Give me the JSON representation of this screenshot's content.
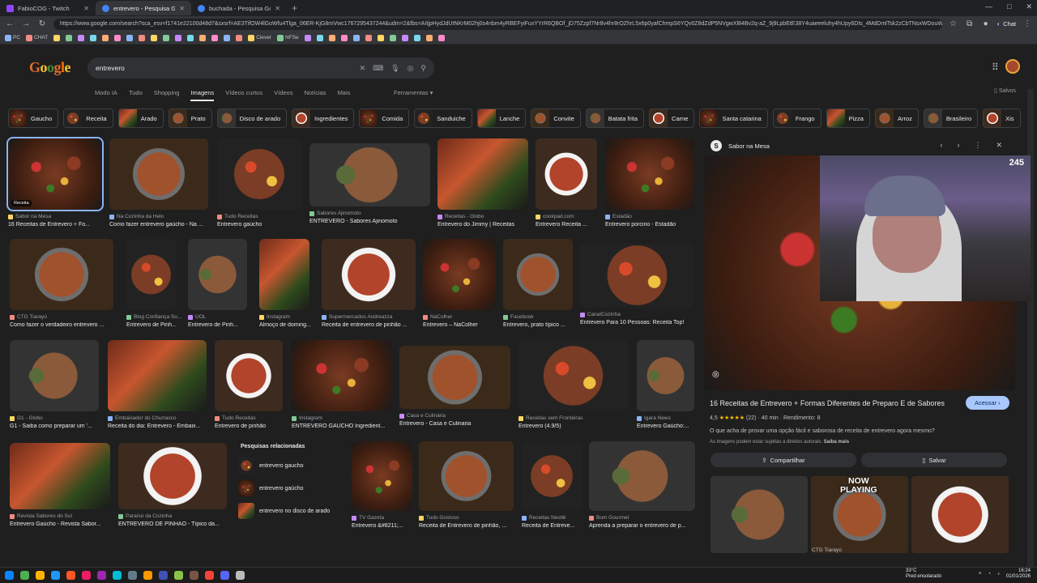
{
  "tabs": [
    {
      "title": "FabioCOG - Twitch",
      "color": "#9146ff"
    },
    {
      "title": "entrevero - Pesquisa Google",
      "color": "#4285f4"
    },
    {
      "title": "buchada - Pesquisa Google",
      "color": "#4285f4"
    }
  ],
  "window_controls": [
    "—",
    "□",
    "✕"
  ],
  "url": "https://www.google.com/search?sca_esv=f1741e22100d48d7&sxsrf=AE3TifOW4lGoWfu4Tlga_06ER-KjG8rnVwc1767295437244&udm=2&fbs=AIIjpHydJdUtNKrM02hj0s4nbm4yRBEFyiFuxYYrR6QBOf_jD75Zzpf7Nr8v4hr8rOZhrL5x6p0yafChmpS6YQv0Z8dZdP5NVgwXl84Bv2q-aZ_9j9LpbEtE38Y4uaeeeluhy4hUpy6DIs_4MdDmlTsk2zCbTNsxWDouWM20Y1P...",
  "chat_label": "Chat",
  "bookmarks": [
    "PC",
    "CHAT",
    "",
    "",
    "",
    "",
    "",
    "",
    "",
    "",
    "",
    "",
    "",
    "",
    "",
    "",
    "",
    "",
    "Clever",
    "NFSe",
    "",
    "",
    "",
    "",
    "",
    "",
    "",
    "",
    "",
    "",
    "",
    ""
  ],
  "search": {
    "query": "entrevero",
    "logo": "Google"
  },
  "search_tabs": [
    "Modo IA",
    "Tudo",
    "Shopping",
    "Imagens",
    "Vídeos curtos",
    "Vídeos",
    "Notícias",
    "Mais"
  ],
  "tools_label": "Ferramentas",
  "saved_label": "Salvos",
  "chips": [
    "Gaucho",
    "Receita",
    "Arado",
    "Prato",
    "Disco de arado",
    "Ingredientes",
    "Comida",
    "Sanduiche",
    "Lanche",
    "Convite",
    "Batata frita",
    "Carne",
    "Santa catarina",
    "Frango",
    "Pizza",
    "Arroz",
    "Brasileiro",
    "Xis"
  ],
  "results": [
    {
      "src": "Sabor na Mesa",
      "title": "16 Receitas de Entrevero + Fo...",
      "badge": "Receita"
    },
    {
      "src": "Na Cozinha da Helo",
      "title": "Como fazer entrevero gaúcho - Na ..."
    },
    {
      "src": "Tudo Receitas",
      "title": "Entrevero gaúcho"
    },
    {
      "src": "Sabores Ajinomoto",
      "title": "ENTREVERO - Sabores Ajinomoto"
    },
    {
      "src": "Receitas - Globo",
      "title": "Entrevero do Jimmy | Receitas"
    },
    {
      "src": "cookpad.com",
      "title": "Entrevero Receita ..."
    },
    {
      "src": "Estadão",
      "title": "Entrevero porcino - Estadão"
    },
    {
      "src": "CTG Tiarayú",
      "title": "Como fazer o verdadeiro entrevero ..."
    },
    {
      "src": "Blog Confiança Su...",
      "title": "Entrevero de Pinh..."
    },
    {
      "src": "UOL",
      "title": "Entrevero de Pinh..."
    },
    {
      "src": "Instagram",
      "title": "Almoço de doming..."
    },
    {
      "src": "Supermercados Andreazza",
      "title": "Receita de entrevero de pinhão ..."
    },
    {
      "src": "NaColher",
      "title": "Entrevero – NaColher"
    },
    {
      "src": "Facebook",
      "title": "Entrevero, prato típico ..."
    },
    {
      "src": "CanalCozinha",
      "title": "Entrevero Para 10 Pessoas: Receita Top!"
    },
    {
      "src": "G1 - Globo",
      "title": "G1 - Saiba como preparar um '..."
    },
    {
      "src": "Embaixador do Churrasco",
      "title": "Receita do dia: Entrevero - Embaix..."
    },
    {
      "src": "Tudo Receitas",
      "title": "Entrevero de pinhão"
    },
    {
      "src": "Instagram",
      "title": "ENTREVERO GAÚCHO Ingredient..."
    },
    {
      "src": "Casa e Culinária",
      "title": "Entrevero - Casa e Culinaria"
    },
    {
      "src": "Receitas sem Fronteiras",
      "title": "Entrevero (4.9/5)"
    },
    {
      "src": "Igara News",
      "title": "Entrevero Gaúcho:..."
    },
    {
      "src": "Revista Sabores do Sul",
      "title": "Entrevero Gaúcho - Revista Sabor..."
    },
    {
      "src": "Paraíso da Cozinha",
      "title": "ENTREVERO DE PINHÃO - Típico da..."
    },
    {
      "src": "TV Gazeta",
      "title": "Entrevero &#8211;..."
    },
    {
      "src": "Tudo Gostoso",
      "title": "Receita de Entrevero de pinhão, ..."
    },
    {
      "src": "Receitas Nestlé",
      "title": "Receita de Entreve..."
    },
    {
      "src": "Bom Gourmet",
      "title": "Aprenda a preparar o entrevero de p..."
    }
  ],
  "related": {
    "heading": "Pesquisas relacionadas",
    "items": [
      "entrevero gaucho",
      "entrevero gaúcho",
      "entrevero no disco de arado"
    ]
  },
  "panel": {
    "source": "Sabor na Mesa",
    "title": "16 Receitas de Entrevero + Formas Diferentes de Preparo E de Sabores",
    "access": "Acessar",
    "rating": "4,5",
    "stars": "★★★★★",
    "reviews": "(22)",
    "time": "40 min",
    "yield": "Rendimento: 8",
    "desc": "O que acha de provar uma opção fácil e saborosa de receita de entrevero agora mesmo?",
    "note": "As imagens podem estar sujeitas a direitos autorais.",
    "note_link": "Saiba mais",
    "share": "Compartilhar",
    "save": "Salvar",
    "thumb_caption": "CTG Tiarayú"
  },
  "overlay": {
    "now": "NOW",
    "playing": "PLAYING",
    "viewers": "245"
  },
  "tray": {
    "weather_temp": "33°C",
    "weather_desc": "Pred ensolarado",
    "time": "16:24",
    "date": "01/01/2026"
  }
}
